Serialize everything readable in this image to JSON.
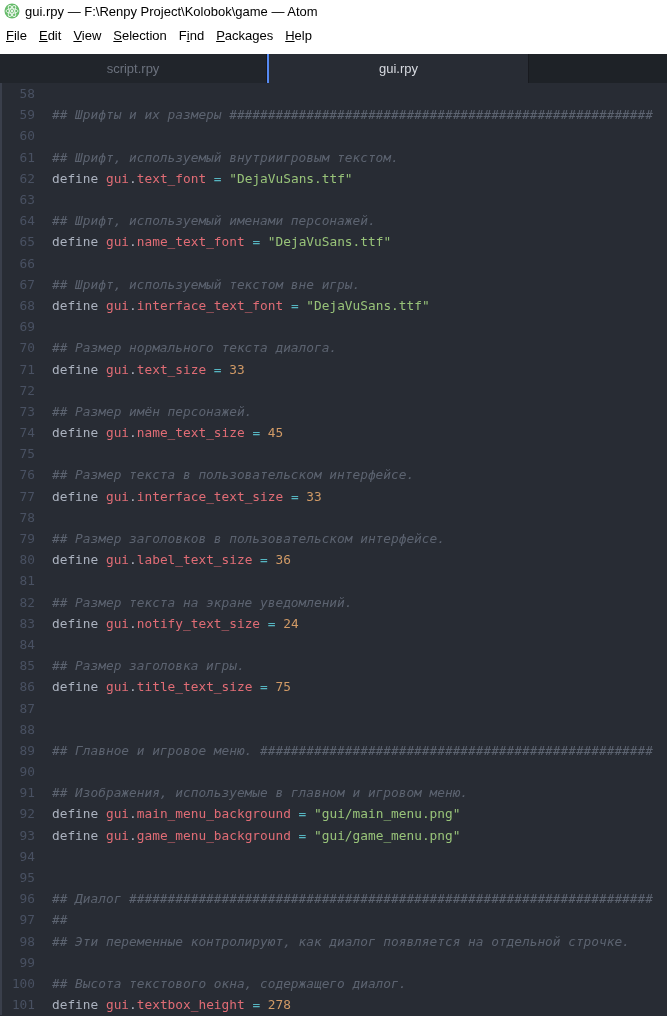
{
  "window": {
    "title": "gui.rpy — F:\\Renpy Project\\Kolobok\\game — Atom"
  },
  "menu": [
    {
      "parts": [
        {
          "text": "F",
          "underlined": true
        },
        {
          "text": "ile",
          "underlined": false
        }
      ]
    },
    {
      "parts": [
        {
          "text": "E",
          "underlined": true
        },
        {
          "text": "dit",
          "underlined": false
        }
      ]
    },
    {
      "parts": [
        {
          "text": "V",
          "underlined": true
        },
        {
          "text": "iew",
          "underlined": false
        }
      ]
    },
    {
      "parts": [
        {
          "text": "S",
          "underlined": true
        },
        {
          "text": "election",
          "underlined": false
        }
      ]
    },
    {
      "parts": [
        {
          "text": "F",
          "underlined": false
        },
        {
          "text": "i",
          "underlined": true
        },
        {
          "text": "nd",
          "underlined": false
        }
      ]
    },
    {
      "parts": [
        {
          "text": "P",
          "underlined": true
        },
        {
          "text": "ackages",
          "underlined": false
        }
      ]
    },
    {
      "parts": [
        {
          "text": "H",
          "underlined": true
        },
        {
          "text": "elp",
          "underlined": false
        }
      ]
    }
  ],
  "tabs": [
    {
      "label": "script.rpy",
      "selected": false
    },
    {
      "label": "gui.rpy",
      "selected": true
    }
  ],
  "editor": {
    "lines": [
      {
        "number": "58",
        "kind": "blank"
      },
      {
        "number": "59",
        "kind": "comment",
        "text": "## Шрифты и их размеры #######################################################"
      },
      {
        "number": "60",
        "kind": "blank"
      },
      {
        "number": "61",
        "kind": "comment",
        "text": "## Шрифт, используемый внутриигровым текстом."
      },
      {
        "number": "62",
        "kind": "define_string",
        "keyword": "define",
        "object": "gui",
        "dot": ".",
        "name": "text_font",
        "operator": "=",
        "value": "\"DejaVuSans.ttf\""
      },
      {
        "number": "63",
        "kind": "blank"
      },
      {
        "number": "64",
        "kind": "comment",
        "text": "## Шрифт, используемый именами персонажей."
      },
      {
        "number": "65",
        "kind": "define_string",
        "keyword": "define",
        "object": "gui",
        "dot": ".",
        "name": "name_text_font",
        "operator": "=",
        "value": "\"DejaVuSans.ttf\""
      },
      {
        "number": "66",
        "kind": "blank"
      },
      {
        "number": "67",
        "kind": "comment",
        "text": "## Шрифт, используемый текстом вне игры."
      },
      {
        "number": "68",
        "kind": "define_string",
        "keyword": "define",
        "object": "gui",
        "dot": ".",
        "name": "interface_text_font",
        "operator": "=",
        "value": "\"DejaVuSans.ttf\""
      },
      {
        "number": "69",
        "kind": "blank"
      },
      {
        "number": "70",
        "kind": "comment",
        "text": "## Размер нормального текста диалога."
      },
      {
        "number": "71",
        "kind": "define_number",
        "keyword": "define",
        "object": "gui",
        "dot": ".",
        "name": "text_size",
        "operator": "=",
        "value": "33"
      },
      {
        "number": "72",
        "kind": "blank"
      },
      {
        "number": "73",
        "kind": "comment",
        "text": "## Размер имён персонажей."
      },
      {
        "number": "74",
        "kind": "define_number",
        "keyword": "define",
        "object": "gui",
        "dot": ".",
        "name": "name_text_size",
        "operator": "=",
        "value": "45"
      },
      {
        "number": "75",
        "kind": "blank"
      },
      {
        "number": "76",
        "kind": "comment",
        "text": "## Размер текста в пользовательском интерфейсе."
      },
      {
        "number": "77",
        "kind": "define_number",
        "keyword": "define",
        "object": "gui",
        "dot": ".",
        "name": "interface_text_size",
        "operator": "=",
        "value": "33"
      },
      {
        "number": "78",
        "kind": "blank"
      },
      {
        "number": "79",
        "kind": "comment",
        "text": "## Размер заголовков в пользовательском интерфейсе."
      },
      {
        "number": "80",
        "kind": "define_number",
        "keyword": "define",
        "object": "gui",
        "dot": ".",
        "name": "label_text_size",
        "operator": "=",
        "value": "36"
      },
      {
        "number": "81",
        "kind": "blank"
      },
      {
        "number": "82",
        "kind": "comment",
        "text": "## Размер текста на экране уведомлений."
      },
      {
        "number": "83",
        "kind": "define_number",
        "keyword": "define",
        "object": "gui",
        "dot": ".",
        "name": "notify_text_size",
        "operator": "=",
        "value": "24"
      },
      {
        "number": "84",
        "kind": "blank"
      },
      {
        "number": "85",
        "kind": "comment",
        "text": "## Размер заголовка игры."
      },
      {
        "number": "86",
        "kind": "define_number",
        "keyword": "define",
        "object": "gui",
        "dot": ".",
        "name": "title_text_size",
        "operator": "=",
        "value": "75"
      },
      {
        "number": "87",
        "kind": "blank"
      },
      {
        "number": "88",
        "kind": "blank"
      },
      {
        "number": "89",
        "kind": "comment",
        "text": "## Главное и игровое меню. ###################################################"
      },
      {
        "number": "90",
        "kind": "blank"
      },
      {
        "number": "91",
        "kind": "comment",
        "text": "## Изображения, используемые в главном и игровом меню."
      },
      {
        "number": "92",
        "kind": "define_string",
        "keyword": "define",
        "object": "gui",
        "dot": ".",
        "name": "main_menu_background",
        "operator": "=",
        "value": "\"gui/main_menu.png\""
      },
      {
        "number": "93",
        "kind": "define_string",
        "keyword": "define",
        "object": "gui",
        "dot": ".",
        "name": "game_menu_background",
        "operator": "=",
        "value": "\"gui/game_menu.png\""
      },
      {
        "number": "94",
        "kind": "blank"
      },
      {
        "number": "95",
        "kind": "blank"
      },
      {
        "number": "96",
        "kind": "comment",
        "text": "## Диалог ####################################################################"
      },
      {
        "number": "97",
        "kind": "comment",
        "text": "##"
      },
      {
        "number": "98",
        "kind": "comment",
        "text": "## Эти переменные контролируют, как диалог появляется на отдельной строчке."
      },
      {
        "number": "99",
        "kind": "blank"
      },
      {
        "number": "100",
        "kind": "comment",
        "text": "## Высота текстового окна, содержащего диалог."
      },
      {
        "number": "101",
        "kind": "define_number",
        "keyword": "define",
        "object": "gui",
        "dot": ".",
        "name": "textbox_height",
        "operator": "=",
        "value": "278"
      }
    ]
  }
}
